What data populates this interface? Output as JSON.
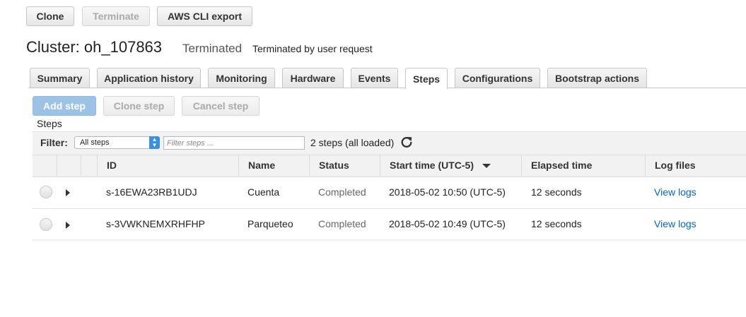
{
  "toolbar": {
    "clone": "Clone",
    "terminate": "Terminate",
    "aws_cli_export": "AWS CLI export"
  },
  "cluster": {
    "title": "Cluster: oh_107863",
    "state": "Terminated",
    "reason": "Terminated by user request"
  },
  "tabs": [
    {
      "label": "Summary"
    },
    {
      "label": "Application history"
    },
    {
      "label": "Monitoring"
    },
    {
      "label": "Hardware"
    },
    {
      "label": "Events"
    },
    {
      "label": "Steps",
      "active": true
    },
    {
      "label": "Configurations"
    },
    {
      "label": "Bootstrap actions"
    }
  ],
  "steps_actions": {
    "add": "Add step",
    "clone": "Clone step",
    "cancel": "Cancel step"
  },
  "steps_label": "Steps",
  "filter": {
    "label": "Filter:",
    "selected": "All steps",
    "placeholder": "Filter steps ...",
    "count": "2 steps (all loaded)",
    "refresh_icon": "refresh-icon"
  },
  "table": {
    "columns": [
      "ID",
      "Name",
      "Status",
      "Start time (UTC-5)",
      "Elapsed time",
      "Log files"
    ],
    "sort_icon": "sort-descending-icon",
    "rows": [
      {
        "id": "s-16EWA23RB1UDJ",
        "name": "Cuenta",
        "status": "Completed",
        "start": "2018-05-02 10:50 (UTC-5)",
        "elapsed": "12 seconds",
        "logs": "View logs"
      },
      {
        "id": "s-3VWKNEMXRHFHP",
        "name": "Parqueteo",
        "status": "Completed",
        "start": "2018-05-02 10:49 (UTC-5)",
        "elapsed": "12 seconds",
        "logs": "View logs"
      }
    ]
  },
  "colors": {
    "accent_blue": "#9cc3e6",
    "link": "#0b62b8",
    "header_bg": "#f2f2f2"
  }
}
